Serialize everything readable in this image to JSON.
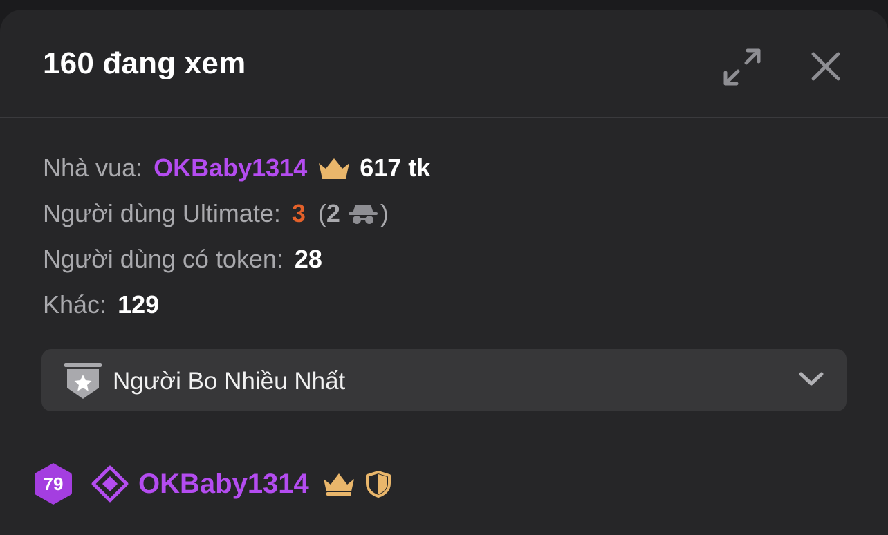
{
  "header": {
    "title": "160 đang xem"
  },
  "stats": {
    "king_label": "Nhà vua:",
    "king_name": "OKBaby1314",
    "king_tokens": "617 tk",
    "ultimate_label": "Người dùng Ultimate:",
    "ultimate_count": "3",
    "ultimate_open": "(",
    "ultimate_anon_count": "2",
    "ultimate_close": ")",
    "token_label": "Người dùng có token:",
    "token_count": "28",
    "other_label": "Khác:",
    "other_count": "129"
  },
  "dropdown": {
    "label": "Người Bo Nhiều Nhất"
  },
  "user": {
    "level": "79",
    "name": "OKBaby1314"
  },
  "colors": {
    "panel_bg": "#262628",
    "accent_purple": "#b44cf0",
    "ultimate_orange": "#e4612a",
    "crown_gold": "#e9b66b",
    "muted_text": "#a9a9ad"
  },
  "icons": {
    "expand": "expand-icon",
    "close": "close-icon",
    "crown": "crown-icon",
    "spy": "incognito-icon",
    "star_badge": "star-badge-icon",
    "chevron": "chevron-down-icon",
    "diamond": "diamond-icon",
    "shield": "shield-icon"
  }
}
